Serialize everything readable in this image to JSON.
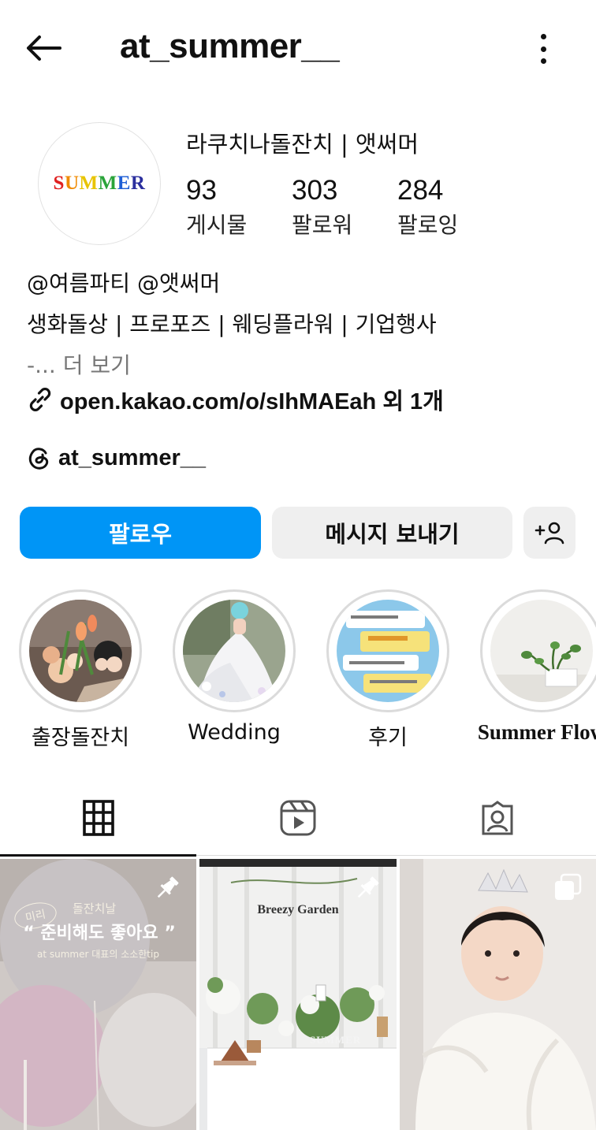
{
  "header": {
    "title": "at_summer__"
  },
  "profile": {
    "avatar_text": "SUMMER",
    "avatar_colors": [
      "#e02020",
      "#f08a00",
      "#e8c400",
      "#2aa43a",
      "#1f5fd6",
      "#2b2f9e",
      "#8a2bb8"
    ],
    "display_name": "라쿠치나돌잔치 | 앳써머",
    "stats": [
      {
        "value": "93",
        "label": "게시물"
      },
      {
        "value": "303",
        "label": "팔로워"
      },
      {
        "value": "284",
        "label": "팔로잉"
      }
    ],
    "bio_lines": [
      "@여름파티 @앳써머",
      "생화돌상 | 프로포즈 | 웨딩플라워 | 기업행사"
    ],
    "bio_more": "-... 더 보기",
    "link": "open.kakao.com/o/sIhMAEah 외 1개",
    "threads_handle": "at_summer__"
  },
  "actions": {
    "follow": "팔로우",
    "message": "메시지 보내기",
    "add_user": "+person"
  },
  "highlights": [
    {
      "label": "출장돌잔치",
      "icon": "flowers-photo"
    },
    {
      "label": "Wedding",
      "icon": "bride-photo"
    },
    {
      "label": "후기",
      "icon": "review-chat-photo"
    },
    {
      "label": "Summer Flow",
      "icon": "plant-photo"
    }
  ],
  "tabs": [
    {
      "name": "grid",
      "icon": "grid-icon",
      "active": true
    },
    {
      "name": "reels",
      "icon": "reels-icon",
      "active": false
    },
    {
      "name": "tagged",
      "icon": "tagged-icon",
      "active": false
    }
  ],
  "posts": [
    {
      "caption_top": "돌잔치날",
      "badge": "미리",
      "caption_main": "“ 준비해도 좋아요 ”",
      "caption_sub": "at summer 대표의 소소한tip",
      "pinned": true
    },
    {
      "caption_main": "Breezy Garden",
      "sign": "SUMMER",
      "pinned": true
    },
    {
      "pinned": false,
      "multi": true
    }
  ]
}
